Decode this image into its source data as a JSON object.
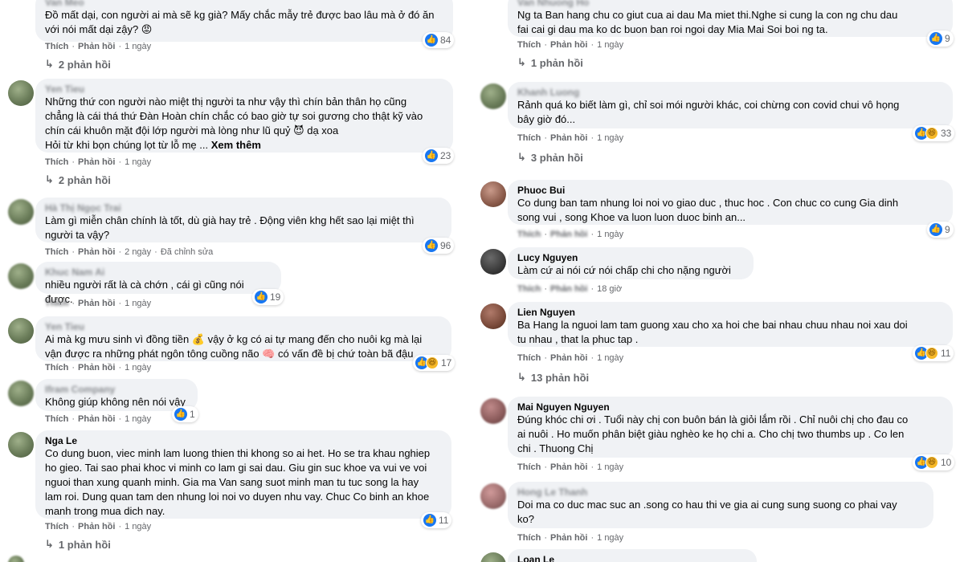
{
  "labels": {
    "like": "Thích",
    "reply": "Phản hồi",
    "see_more": "Xem thêm",
    "edited": "Đã chỉnh sửa",
    "sep": "·"
  },
  "left": [
    {
      "author": "Van Meo",
      "text": "Đồ mất dại, con người ai mà sẽ kg già? Mấy chắc mẫy trẻ được bao lâu mà ở đó ăn\nvới nói mất dại zậy? 😡",
      "reactions": "84",
      "time": "1 ngày",
      "replies": "2 phản hồi"
    },
    {
      "author": "Yen Tieu",
      "text": "Những thứ con người nào miệt thị người ta như vậy thì chín bản thân họ cũng\nchẳng là cái thá thứ Đàn Hoàn chín chắc có bao giờ tự soi gương cho thật kỹ vào\nchín cái khuôn mặt đội lớp người mà lòng như lũ quỷ 😈 dạ xoa\nHỏi từ khi bọn chúng lọt từ lỗ mẹ ...",
      "reactions": "23",
      "time": "1 ngày",
      "replies": "2 phản hồi"
    },
    {
      "author": "Hà Thị Ngọc Trai",
      "text": "Làm gì miễn chân chính là tốt, dù già hay trẻ . Động viên khg hết sao lại miệt thì\nngười ta vậy?",
      "reactions": "96",
      "time": "2 ngày"
    },
    {
      "author": "Khuc Nam Ai",
      "text": "nhiều người rất là cà chớn , cái gì cũng nói được.",
      "reactions": "19",
      "time": "1 ngày"
    },
    {
      "author": "Yen Tieu",
      "text": "Ai mà kg mưu sinh vì đồng tiền 💰 vậy ở kg có ai tự mang đến cho nuôi kg mà lại\nvận được ra những phát ngôn tông cuồng não 🧠 có vấn đề bị chứ toàn bã đậu",
      "reactions": "17",
      "time": "1 ngày"
    },
    {
      "author": "Ifram Company",
      "text": "Không giúp không nên nói vậy",
      "reactions": "1",
      "time": "1 ngày"
    },
    {
      "author": "Nga Le",
      "text": "Co dung buon, viec minh lam luong thien thi khong so ai het. Ho se tra khau nghiep\nho gieo. Tai sao phai khoc vi minh co lam gi sai dau. Giu gin suc khoe va vui ve voi\nnguoi than xung quanh minh. Gia ma Van sang suot minh man tu tuc song la hay\nlam roi. Dung quan tam den nhung loi noi vo duyen nhu vay. Chuc Co binh an khoe\nmanh trong mua dich nay.",
      "reactions": "11",
      "time": "1 ngày",
      "replies": "1 phản hồi"
    }
  ],
  "right": [
    {
      "author": "Van Nhuong Ho",
      "text": "Ng ta Ban hang chu co giut cua ai dau Ma miet thi.Nghe si cung la con ng chu dau\nfai cai gi dau ma ko dc buon ban roi ngoi day Mia Mai Soi boi ng ta.",
      "reactions": "9",
      "time": "1 ngày",
      "replies": "1 phản hồi"
    },
    {
      "author": "Khanh Luong",
      "text": "Rảnh quá ko biết làm gì, chỉ soi mói người khác, coi chừng con covid chui vô họng\nbây giờ đó...",
      "reactions": "33",
      "time": "1 ngày",
      "replies": "3 phản hồi"
    },
    {
      "author": "Phuoc Bui",
      "text": "Co dung ban tam nhung loi noi vo giao duc , thuc hoc . Con chuc co cung Gia dinh\nsong vui , song Khoe va luon luon duoc binh an...",
      "reactions": "9",
      "time": "1 ngày"
    },
    {
      "author": "Lucy Nguyen",
      "text": "Làm cứ ai nói cứ nói chấp chi cho nặng người",
      "time": "18 giờ"
    },
    {
      "author": "Lien Nguyen",
      "text": "Ba Hang la nguoi lam tam guong xau cho xa hoi che bai nhau chuu nhau noi xau doi\ntu nhau , that la phuc tap .",
      "reactions": "11",
      "time": "1 ngày",
      "replies": "13 phản hồi"
    },
    {
      "author": "Mai Nguyen Nguyen",
      "text": "Đúng khóc chi ơi . Tuổi này chị con buôn bán là giỏi lắm rồi . Chỉ nuôi chị cho đau co\nai nuôi . Ho muốn phân biệt giàu nghèo ke họ chi a. Cho chị two thumbs up . Co len\nchi . Thuong Chị",
      "reactions": "10",
      "time": "1 ngày"
    },
    {
      "author": "Hong Le Thanh",
      "text": "Doi ma co duc mac suc an .song co hau thi ve gia ai cung sung suong co phai vay\nko?",
      "time": "1 ngày"
    },
    {
      "author": "Loan Le",
      "text": ""
    }
  ]
}
